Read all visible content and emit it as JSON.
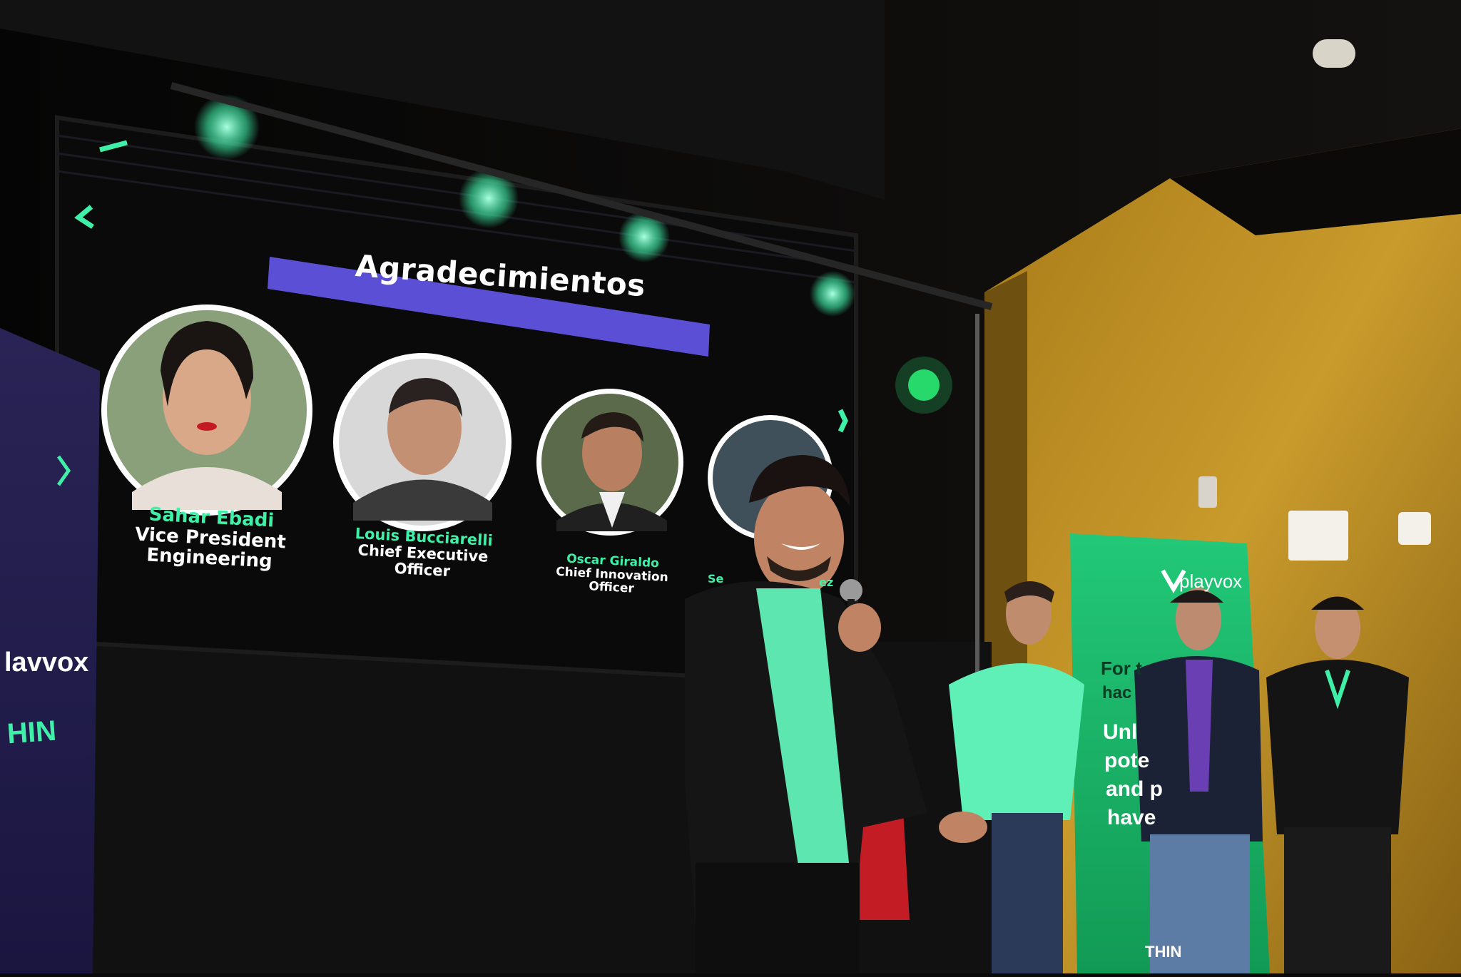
{
  "slide": {
    "title": "Agradecimientos",
    "people": [
      {
        "name": "Sahar Ebadi",
        "role_line1": "Vice President",
        "role_line2": "Engineering"
      },
      {
        "name": "Louis Bucciarelli",
        "role_line1": "Chief Executive",
        "role_line2": "Officer"
      },
      {
        "name": "Oscar Giraldo",
        "role_line1": "Chief Innovation",
        "role_line2": "Officer"
      },
      {
        "name": "Se",
        "name_tail": "ez"
      }
    ]
  },
  "left_banner": {
    "brand": "lavvox",
    "event_fragment": "HIN"
  },
  "right_banner": {
    "brand": "playvox",
    "line1": "For t",
    "line2": "hac",
    "line3": "Unl",
    "line4": "pote",
    "line5": "and p",
    "line6": "have",
    "footer": "THIN"
  },
  "colors": {
    "accent_green": "#3ef0a8",
    "banner_green": "#1ec36f",
    "slide_bar": "#5b4fd6",
    "wall_yellow": "#c79a2a"
  }
}
